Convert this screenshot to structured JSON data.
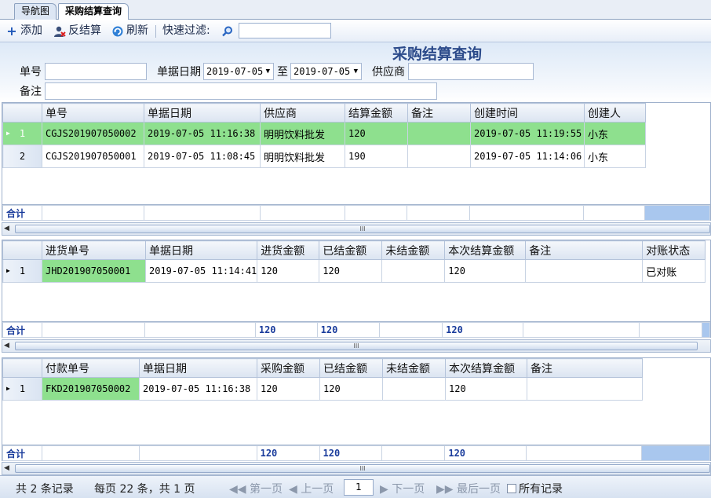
{
  "tabs": [
    "导航图",
    "采购结算查询"
  ],
  "toolbar": {
    "add": "添加",
    "reverse": "反结算",
    "refresh": "刷新",
    "filter_label": "快速过滤:"
  },
  "form": {
    "title": "采购结算查询",
    "no_label": "单号",
    "date_label": "单据日期",
    "date_from": "2019-07-05",
    "to_label": "至",
    "date_to": "2019-07-05",
    "supplier_label": "供应商",
    "remark_label": "备注"
  },
  "grid1": {
    "columns": [
      "单号",
      "单据日期",
      "供应商",
      "结算金额",
      "备注",
      "创建时间",
      "创建人"
    ],
    "rows": [
      {
        "idx": "1",
        "no": "CGJS201907050002",
        "date": "2019-07-05 11:16:38",
        "supplier": "明明饮料批发",
        "amount": "120",
        "remark": "",
        "created": "2019-07-05 11:19:55",
        "creator": "小东"
      },
      {
        "idx": "2",
        "no": "CGJS201907050001",
        "date": "2019-07-05 11:08:45",
        "supplier": "明明饮料批发",
        "amount": "190",
        "remark": "",
        "created": "2019-07-05 11:14:06",
        "creator": "小东"
      }
    ],
    "sum_label": "合计"
  },
  "grid2": {
    "columns": [
      "进货单号",
      "单据日期",
      "进货金额",
      "已结金额",
      "未结金额",
      "本次结算金额",
      "备注",
      "对账状态"
    ],
    "rows": [
      {
        "idx": "1",
        "no": "JHD201907050001",
        "date": "2019-07-05 11:14:41",
        "amount": "120",
        "settled": "120",
        "unsettled": "",
        "current": "120",
        "remark": "",
        "status": "已对账"
      }
    ],
    "sum_label": "合计",
    "sum_amount": "120",
    "sum_settled": "120",
    "sum_current": "120"
  },
  "grid3": {
    "columns": [
      "付款单号",
      "单据日期",
      "采购金额",
      "已结金额",
      "未结金额",
      "本次结算金额",
      "备注"
    ],
    "rows": [
      {
        "idx": "1",
        "no": "FKD201907050002",
        "date": "2019-07-05 11:16:38",
        "amount": "120",
        "settled": "120",
        "unsettled": "",
        "current": "120",
        "remark": ""
      }
    ],
    "sum_label": "合计",
    "sum_amount": "120",
    "sum_settled": "120",
    "sum_current": "120"
  },
  "pager": {
    "total": "共 2 条记录",
    "per_page": "每页 22 条，共 1 页",
    "first": "第一页",
    "prev": "上一页",
    "page": "1",
    "next": "下一页",
    "last": "最后一页",
    "all": "所有记录"
  },
  "icons": {
    "add": "plus-icon",
    "reverse": "user-revert-icon",
    "refresh": "refresh-icon",
    "search": "search-icon"
  }
}
